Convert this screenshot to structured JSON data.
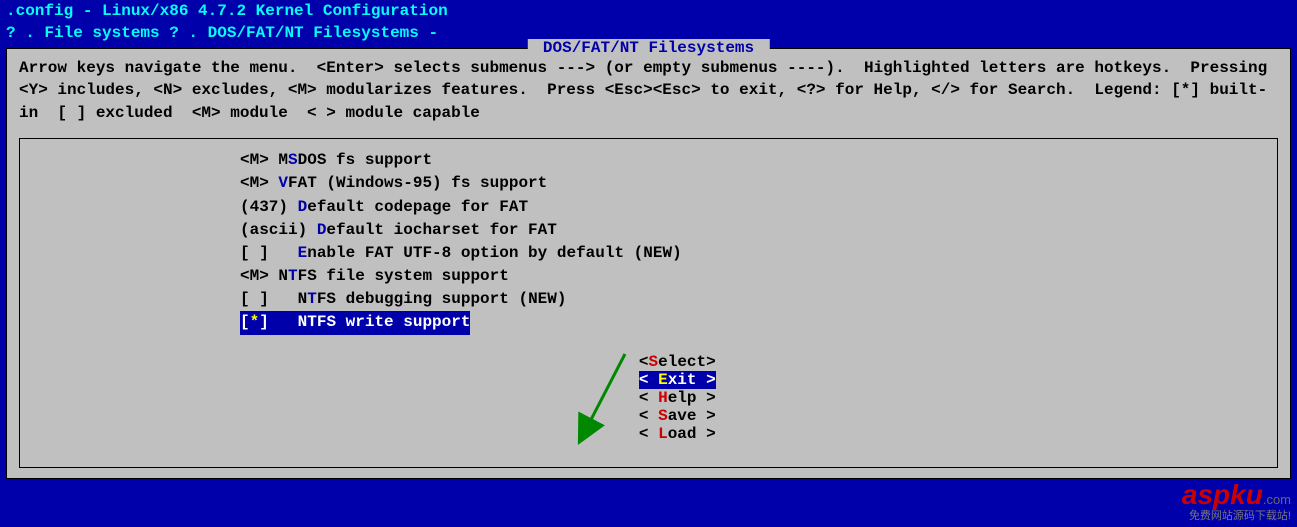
{
  "title": ".config - Linux/x86 4.7.2 Kernel Configuration",
  "breadcrumb": "? . File systems ? . DOS/FAT/NT Filesystems -",
  "panel_title": " DOS/FAT/NT Filesystems ",
  "help_text": "Arrow keys navigate the menu.  <Enter> selects submenus ---> (or empty submenus ----).  Highlighted letters are hotkeys.  Pressing <Y> includes, <N> excludes, <M> modularizes features.  Press <Esc><Esc> to exit, <?> for Help, </> for Search.  Legend: [*] built-in  [ ] excluded  <M> module  < > module capable",
  "menu": [
    {
      "prefix": "<M> M",
      "hot": "S",
      "rest": "DOS fs support",
      "selected": false
    },
    {
      "prefix": "<M> ",
      "hot": "V",
      "rest": "FAT (Windows-95) fs support",
      "selected": false
    },
    {
      "prefix": "(437) ",
      "hot": "D",
      "rest": "efault codepage for FAT",
      "selected": false
    },
    {
      "prefix": "(ascii) ",
      "hot": "D",
      "rest": "efault iocharset for FAT",
      "selected": false
    },
    {
      "prefix": "[ ]   ",
      "hot": "E",
      "rest": "nable FAT UTF-8 option by default (NEW)",
      "selected": false
    },
    {
      "prefix": "<M> N",
      "hot": "T",
      "rest": "FS file system support",
      "selected": false
    },
    {
      "prefix": "[ ]   N",
      "hot": "T",
      "rest": "FS debugging support (NEW)",
      "selected": false
    },
    {
      "prefix": "[",
      "star": "*",
      "mid": "]   ",
      "hot": "N",
      "rest": "TFS write support",
      "selected": true
    }
  ],
  "buttons": [
    {
      "open": "<",
      "hot": "S",
      "rest": "elect>",
      "selected": false
    },
    {
      "open": "< ",
      "hot": "E",
      "rest": "xit >",
      "selected": true
    },
    {
      "open": "< ",
      "hot": "H",
      "rest": "elp >",
      "selected": false
    },
    {
      "open": "< ",
      "hot": "S",
      "rest": "ave >",
      "selected": false
    },
    {
      "open": "< ",
      "hot": "L",
      "rest": "oad >",
      "selected": false
    }
  ],
  "watermark": {
    "brand": "aspku",
    "suffix": ".com",
    "tag": "免费网站源码下载站!"
  }
}
